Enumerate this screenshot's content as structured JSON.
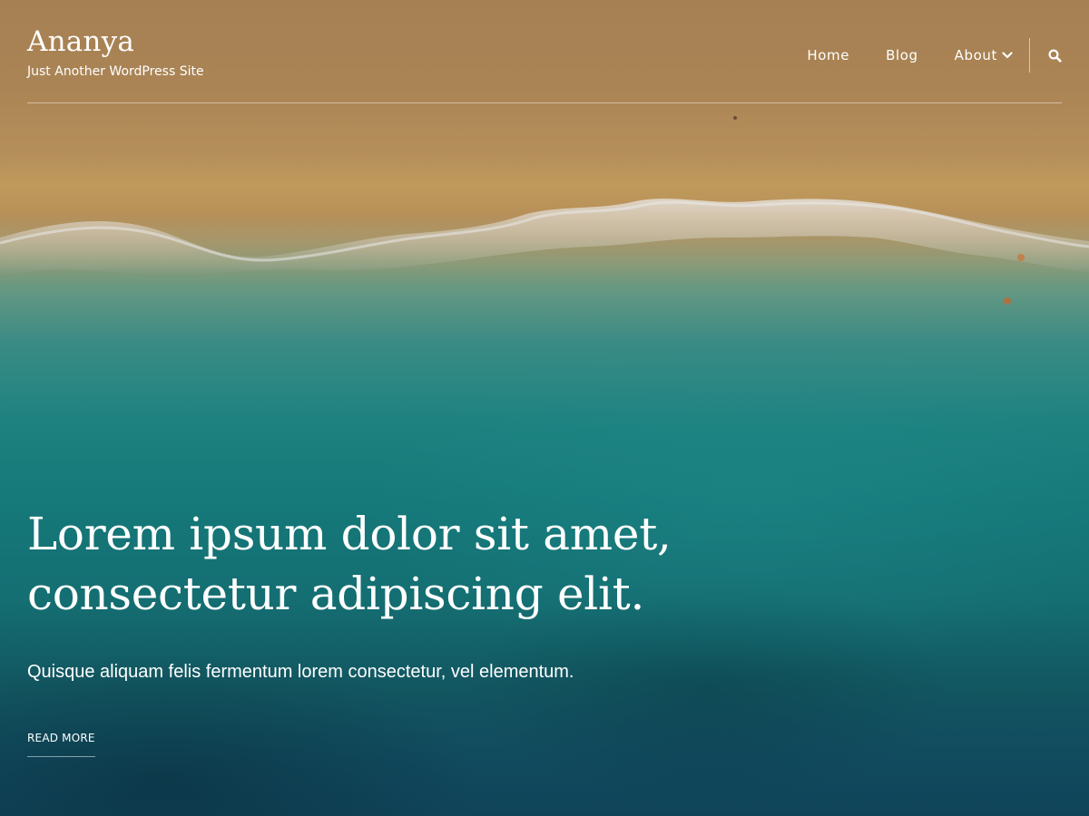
{
  "site": {
    "title": "Ananya",
    "tagline": "Just Another WordPress Site"
  },
  "nav": {
    "items": [
      {
        "label": "Home"
      },
      {
        "label": "Blog"
      },
      {
        "label": "About",
        "has_dropdown": true
      }
    ],
    "search_icon": "search-icon",
    "dropdown_icon": "chevron-down-icon"
  },
  "hero": {
    "heading_line1": "Lorem ipsum dolor sit amet,",
    "heading_line2": "consectetur adipiscing elit.",
    "subheading": "Quisque aliquam felis fermentum lorem consectetur, vel elementum.",
    "cta_label": "READ MORE",
    "background": "aerial photo of sandy beach and turquoise sea"
  },
  "colors": {
    "text": "#ffffff",
    "sand": "#c49a62",
    "sea": "#178485",
    "deep_sea": "#124c63"
  }
}
